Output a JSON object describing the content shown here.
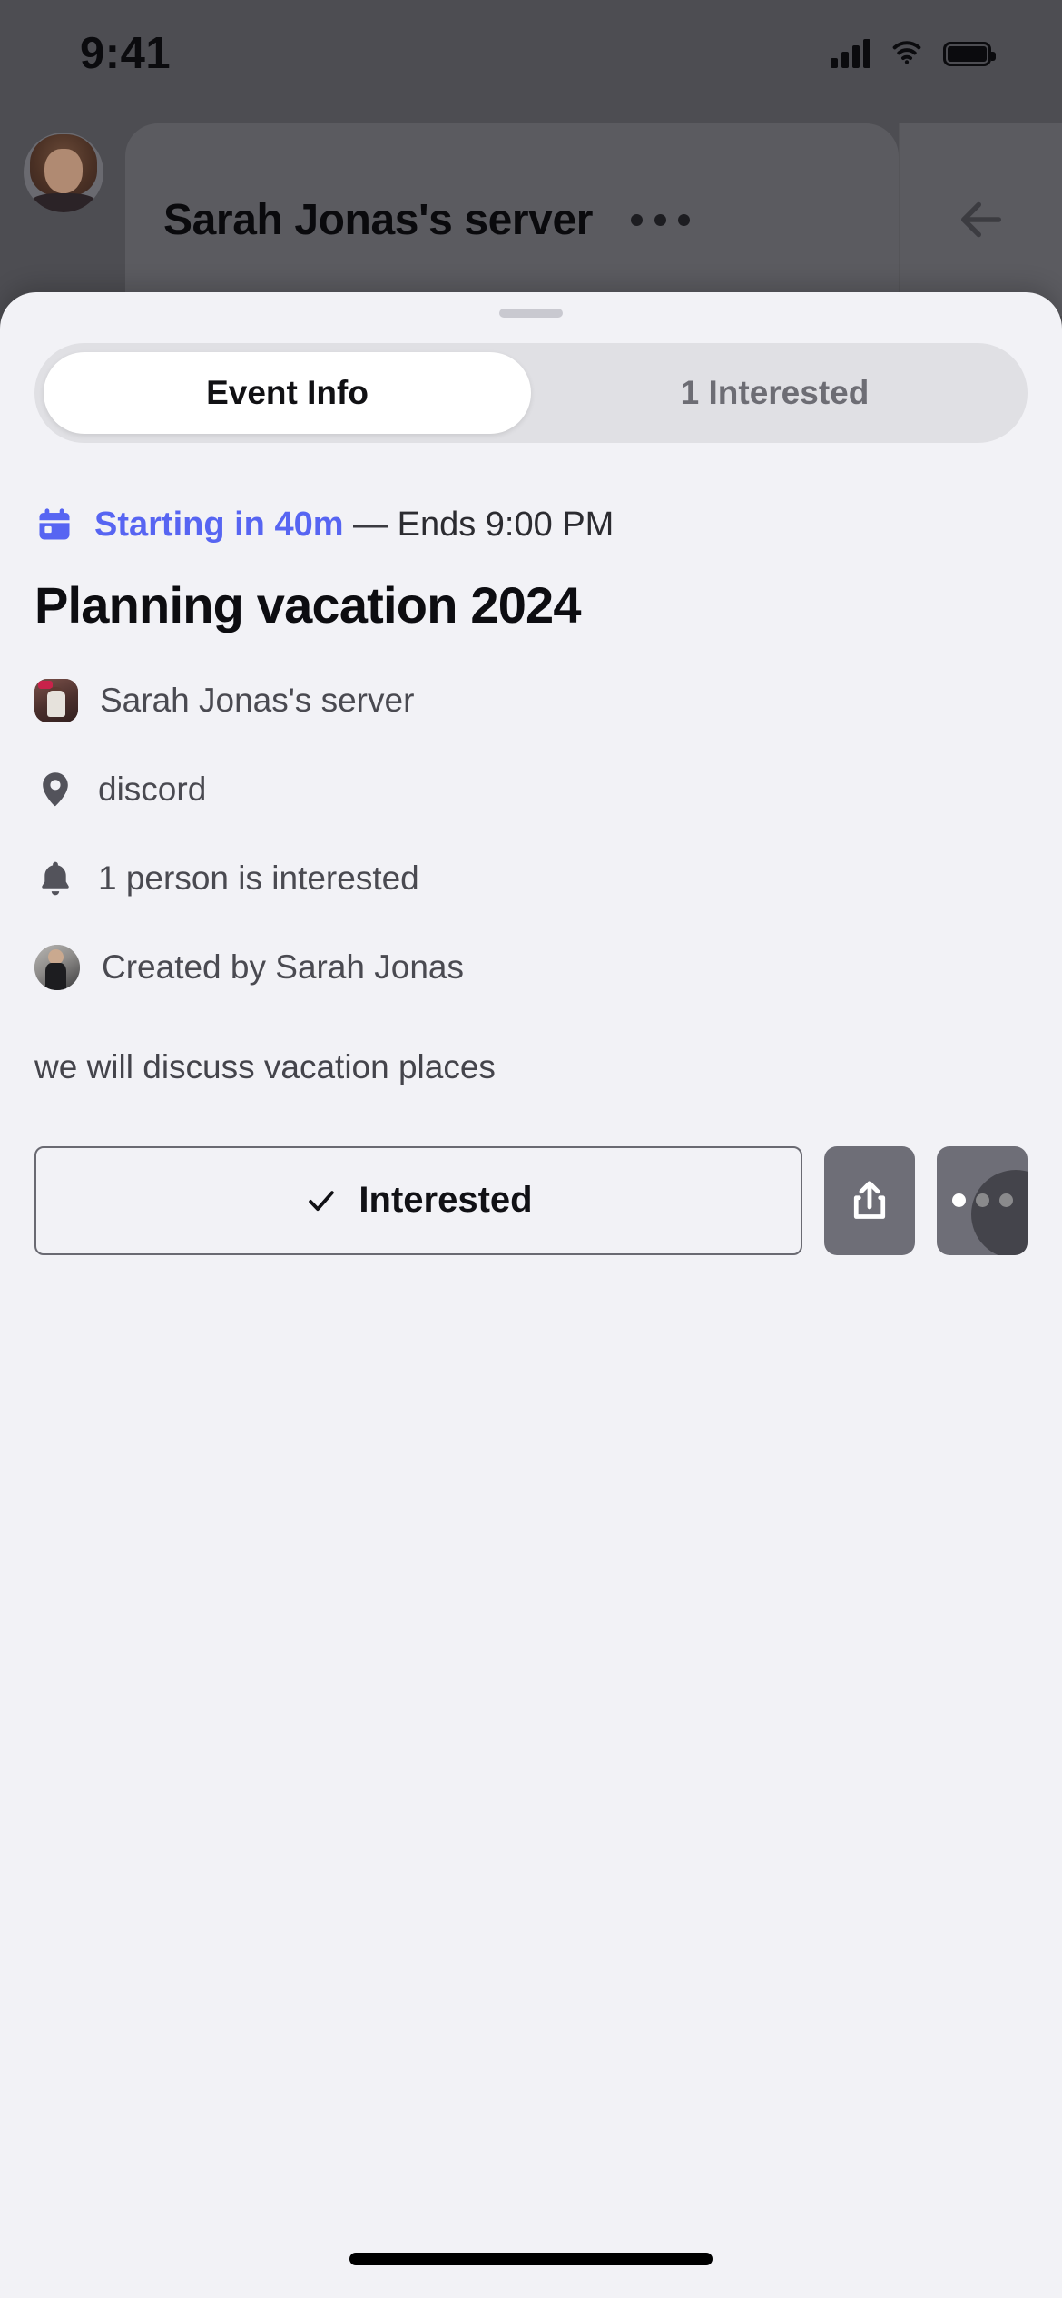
{
  "status_bar": {
    "time": "9:41",
    "signal_icon": "cellular-signal-icon",
    "wifi_icon": "wifi-icon",
    "battery_icon": "battery-icon"
  },
  "app_header": {
    "avatar": "user-avatar",
    "server_name": "Sarah Jonas's server",
    "overflow_icon": "more-options-icon",
    "back_icon": "back-arrow-icon"
  },
  "sheet": {
    "grab_handle": "drag-handle",
    "tabs": [
      {
        "label": "Event Info",
        "active": true
      },
      {
        "label": "1 Interested",
        "active": false
      }
    ],
    "time_row": {
      "icon": "calendar-icon",
      "starting": "Starting in 40m",
      "separator": " — ",
      "ends": "Ends 9:00 PM",
      "accent_color": "#5765f2"
    },
    "event_title": "Planning vacation 2024",
    "meta": [
      {
        "icon": "server-avatar",
        "text": "Sarah Jonas's server"
      },
      {
        "icon": "location-pin-icon",
        "text": "discord"
      },
      {
        "icon": "bell-icon",
        "text": "1 person is interested"
      },
      {
        "icon": "creator-avatar",
        "text": "Created by Sarah Jonas"
      }
    ],
    "description": "we will discuss vacation places",
    "actions": {
      "interested_label": "Interested",
      "interested_icon": "check-icon",
      "share_icon": "share-icon",
      "more_icon": "more-horizontal-icon"
    }
  },
  "home_indicator": "home-indicator"
}
